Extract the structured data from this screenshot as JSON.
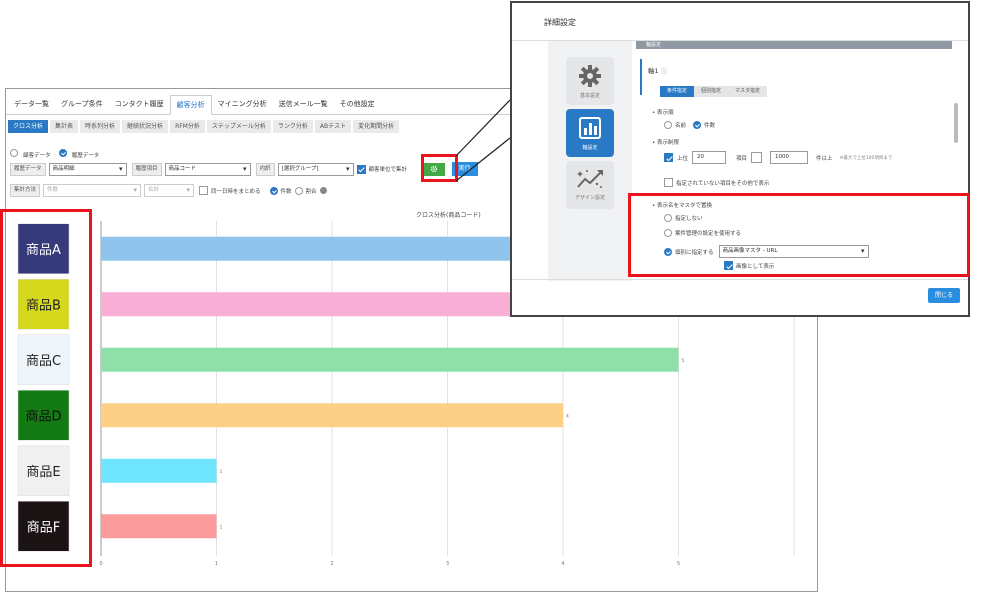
{
  "main_tabs": [
    {
      "label": "データ一覧",
      "active": false
    },
    {
      "label": "グループ条件",
      "active": false
    },
    {
      "label": "コンタクト履歴",
      "active": false
    },
    {
      "label": "顧客分析",
      "active": true
    },
    {
      "label": "マイニング分析",
      "active": false
    },
    {
      "label": "送信メール一覧",
      "active": false
    },
    {
      "label": "その他設定",
      "active": false
    }
  ],
  "analysis_tabs": [
    {
      "label": "クロス分析",
      "active": true
    },
    {
      "label": "集計表",
      "active": false
    },
    {
      "label": "時系列分析",
      "active": false
    },
    {
      "label": "継続状況分析",
      "active": false
    },
    {
      "label": "RFM分析",
      "active": false
    },
    {
      "label": "ステップメール分析",
      "active": false
    },
    {
      "label": "ランク分析",
      "active": false
    },
    {
      "label": "ABテスト",
      "active": false
    },
    {
      "label": "変化期間分析",
      "active": false
    }
  ],
  "data_type": {
    "option1": "顧客データ",
    "option2": "履歴データ",
    "selected": 2
  },
  "filters": {
    "history_label": "履歴データ",
    "history_value": "商品明細",
    "history_item_label": "履歴項目",
    "history_item_value": "商品コード",
    "breakdown_label": "内訳",
    "breakdown_value": "[選択グループ]",
    "customer_unit_label": "顧客単位で集計",
    "run_label": "実行",
    "method_label": "集計方法",
    "method_value": "件数",
    "agg_value": "合計",
    "same_day_label": "同一日時をまとめる",
    "count_label": "件数",
    "ratio_label": "割合"
  },
  "icons": {
    "settings": "gear-icon",
    "help": "help-icon",
    "basic": "gear-icon",
    "axis": "bar-chart-icon",
    "design": "sparkle-chart-icon"
  },
  "chart_data": {
    "type": "bar",
    "orientation": "horizontal",
    "title": "クロス分析(商品コード)",
    "categories": [
      "商品A",
      "商品B",
      "商品C",
      "商品D",
      "商品E",
      "商品F"
    ],
    "values": [
      7,
      7,
      5,
      4,
      1,
      1
    ],
    "data_labels": [
      "",
      "",
      "5",
      "4",
      "1",
      "1"
    ],
    "bar_colors": [
      "#8fc5ec",
      "#f9aed5",
      "#8ee0a8",
      "#fdd088",
      "#6fe5ff",
      "#fb9b9b"
    ],
    "xlim": [
      0,
      6
    ],
    "xticks": [
      "0",
      "1",
      "2",
      "3",
      "4",
      "5"
    ],
    "grid": true,
    "category_images": [
      {
        "label": "商品A",
        "bg": "#363a7a",
        "fg": "#ffffff"
      },
      {
        "label": "商品B",
        "bg": "#d6d81d",
        "fg": "#222222"
      },
      {
        "label": "商品C",
        "bg": "#eef5fb",
        "fg": "#222222"
      },
      {
        "label": "商品D",
        "bg": "#147a13",
        "fg": "#111111"
      },
      {
        "label": "商品E",
        "bg": "#f0f0f0",
        "fg": "#222222"
      },
      {
        "label": "商品F",
        "bg": "#1c1414",
        "fg": "#ffffff"
      }
    ]
  },
  "dialog": {
    "title": "詳細設定",
    "header_strip": "軸設定",
    "side_items": [
      {
        "label": "基本設定",
        "active": false
      },
      {
        "label": "軸設定",
        "active": true
      },
      {
        "label": "デザイン設定",
        "active": false
      }
    ],
    "axis_title": "軸1",
    "seg_tabs": [
      {
        "label": "条件指定",
        "active": true
      },
      {
        "label": "個別指定",
        "active": false
      },
      {
        "label": "マスタ指定",
        "active": false
      }
    ],
    "display_order_label": "表示順",
    "order_name": "名前",
    "order_count": "件数",
    "display_limit_label": "表示制限",
    "limit_top": "上位",
    "limit_top_value": "20",
    "limit_items": "項目",
    "limit_count_value": "1000",
    "limit_over": "件以上",
    "limit_note": "※最大で上位100項目まで",
    "show_others": "指定されていない項目をその他で表示",
    "replace_label": "表示名をマスタで置換",
    "replace_none": "指定しない",
    "replace_case": "案件管理の設定を使用する",
    "replace_custom": "個別に指定する",
    "master_value": "商品画像マスタ - URL",
    "show_image": "画像として表示",
    "close_label": "閉じる"
  }
}
